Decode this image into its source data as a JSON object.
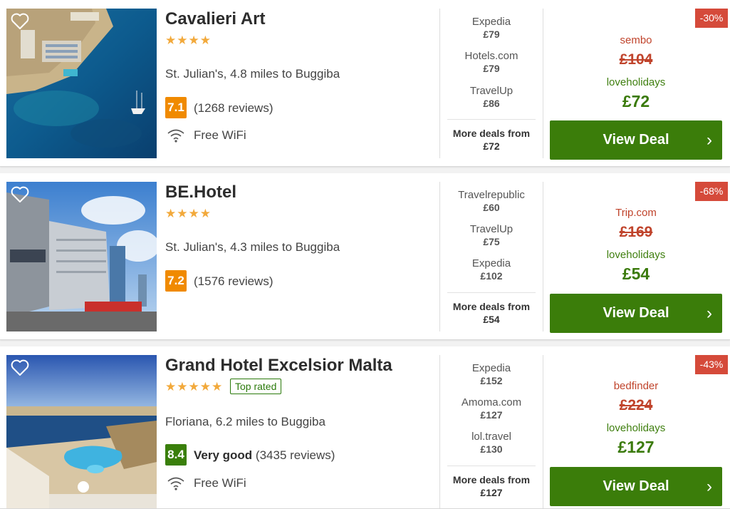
{
  "hotels": [
    {
      "name": "Cavalieri Art",
      "stars": "★★★★",
      "location": "St. Julian's, 4.8 miles to Buggiba",
      "score": "7.1",
      "score_label": "",
      "reviews": "(1268 reviews)",
      "amenity": "Free WiFi",
      "deals": [
        {
          "provider": "Expedia",
          "price": "£79"
        },
        {
          "provider": "Hotels.com",
          "price": "£79"
        },
        {
          "provider": "TravelUp",
          "price": "£86"
        }
      ],
      "more_label": "More deals from",
      "more_price": "£72",
      "discount": "-30%",
      "main_provider": "sembo",
      "old_price": "£104",
      "best_provider": "loveholidays",
      "best_price": "£72",
      "button": "View Deal"
    },
    {
      "name": "BE.Hotel",
      "stars": "★★★★",
      "location": "St. Julian's, 4.3 miles to Buggiba",
      "score": "7.2",
      "score_label": "",
      "reviews": "(1576 reviews)",
      "amenity": "",
      "deals": [
        {
          "provider": "Travelrepublic",
          "price": "£60"
        },
        {
          "provider": "TravelUp",
          "price": "£75"
        },
        {
          "provider": "Expedia",
          "price": "£102"
        }
      ],
      "more_label": "More deals from",
      "more_price": "£54",
      "discount": "-68%",
      "main_provider": "Trip.com",
      "old_price": "£169",
      "best_provider": "loveholidays",
      "best_price": "£54",
      "button": "View Deal"
    },
    {
      "name": "Grand Hotel Excelsior Malta",
      "stars": "★★★★★",
      "badge": "Top rated",
      "location": "Floriana, 6.2 miles to Buggiba",
      "score": "8.4",
      "score_label": "Very good",
      "reviews": "(3435 reviews)",
      "amenity": "Free WiFi",
      "deals": [
        {
          "provider": "Expedia",
          "price": "£152"
        },
        {
          "provider": "Amoma.com",
          "price": "£127"
        },
        {
          "provider": "lol.travel",
          "price": "£130"
        }
      ],
      "more_label": "More deals from",
      "more_price": "£127",
      "discount": "-43%",
      "main_provider": "bedfinder",
      "old_price": "£224",
      "best_provider": "loveholidays",
      "best_price": "£127",
      "button": "View Deal"
    }
  ],
  "icons": {
    "favorite": "heart-icon",
    "wifi": "wifi-icon",
    "arrow": "chevron-right-icon"
  },
  "colors": {
    "accent_green": "#3b7d0a",
    "discount_red": "#d54a3a",
    "score_orange": "#f08a00",
    "score_green": "#3a7f0b",
    "star_orange": "#f2a93b"
  }
}
